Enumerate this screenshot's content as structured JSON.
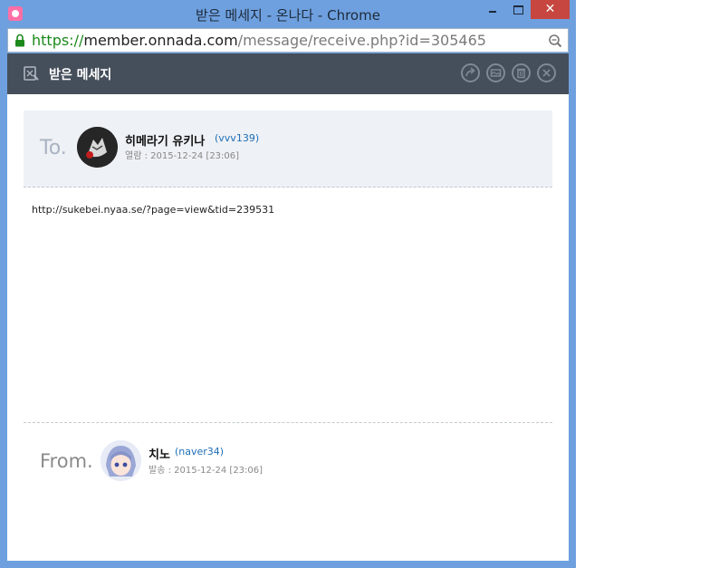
{
  "window": {
    "title": "받은 메세지 - 온나다 - Chrome",
    "close_glyph": "✕"
  },
  "address_bar": {
    "scheme": "https://",
    "host": "member.onnada.com",
    "path": "/message/receive.php?id=305465"
  },
  "header": {
    "title": "받은 메세지",
    "actions": [
      "reply-icon",
      "save-icon",
      "delete-icon",
      "close-icon"
    ]
  },
  "recipient": {
    "label": "To.",
    "name": "히메라기 유키나",
    "user_id": "(vvv139)",
    "meta": "열람 : 2015-12-24 [23:06]"
  },
  "message": {
    "body": "http://sukebei.nyaa.se/?page=view&tid=239531"
  },
  "sender": {
    "label": "From.",
    "name": "치노",
    "user_id": "(naver34)",
    "meta": "발송 : 2015-12-24 [23:06]"
  },
  "colors": {
    "window_frame": "#6ea0df",
    "header_bg": "#454f5b",
    "to_box_bg": "#eef1f5",
    "link_blue": "#1e6fb8",
    "close_button": "#c7463f"
  }
}
